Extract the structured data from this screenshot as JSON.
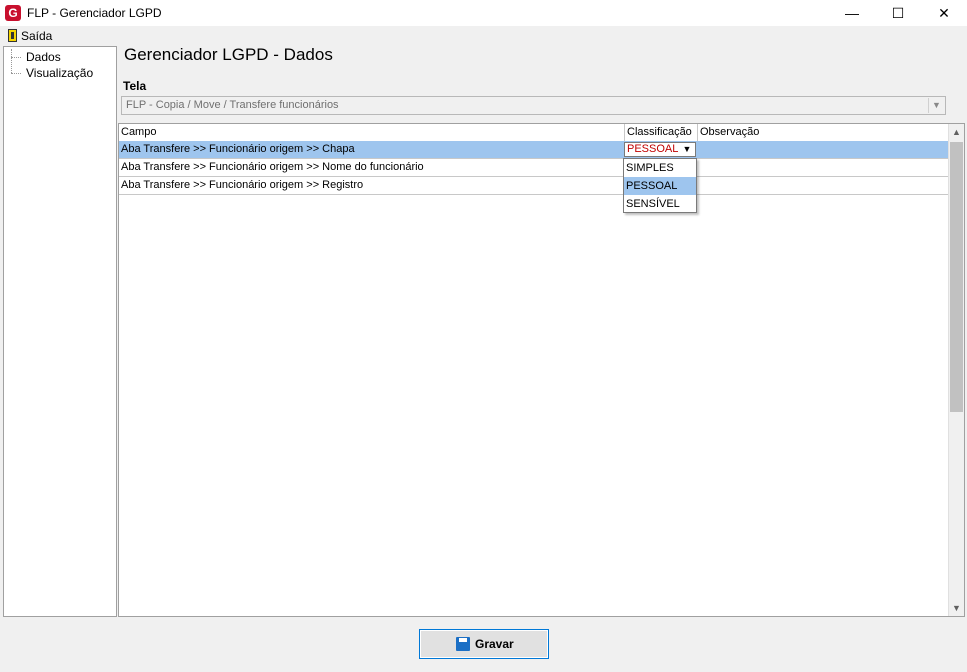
{
  "window": {
    "title": "FLP - Gerenciador LGPD",
    "app_icon_glyph": "G",
    "minimize": "—",
    "maximize": "☐",
    "close": "✕"
  },
  "menu": {
    "exit_label": "Saída"
  },
  "sidebar": {
    "items": [
      {
        "label": "Dados"
      },
      {
        "label": "Visualização"
      }
    ]
  },
  "main": {
    "heading": "Gerenciador LGPD - Dados",
    "tela_label": "Tela",
    "tela_value": "FLP - Copia / Move / Transfere funcionários"
  },
  "grid": {
    "columns": [
      "Campo",
      "Classificação",
      "Observação"
    ],
    "rows": [
      {
        "campo": "Aba Transfere >> Funcionário origem >> Chapa",
        "classificacao": "PESSOAL",
        "observacao": ""
      },
      {
        "campo": "Aba Transfere >> Funcionário origem >> Nome do funcionário",
        "classificacao": "",
        "observacao": ""
      },
      {
        "campo": "Aba Transfere >> Funcionário origem >> Registro",
        "classificacao": "",
        "observacao": ""
      }
    ],
    "dropdown_options": [
      "SIMPLES",
      "PESSOAL",
      "SENSÍVEL"
    ],
    "selected_option": "PESSOAL"
  },
  "footer": {
    "save_label": "Gravar"
  },
  "colors": {
    "selection": "#9ec5ee",
    "editor_text": "#c00000",
    "focus_border": "#0078d7"
  }
}
